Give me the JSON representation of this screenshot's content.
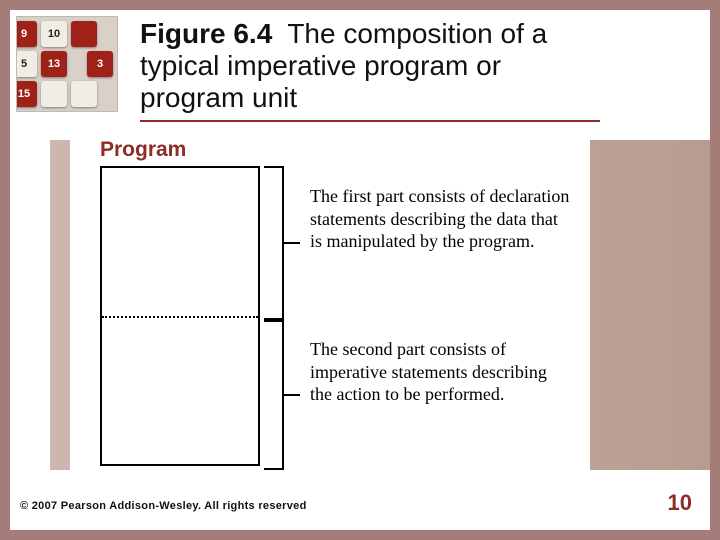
{
  "title": {
    "fignum": "Figure 6.4",
    "rest": "  The composition of a typical imperative program or program unit"
  },
  "diagram": {
    "label": "Program",
    "part1": "The first part consists of declaration statements describing the data that is manipulated by the program.",
    "part2": "The second part consists of imperative statements describing the action to be performed."
  },
  "footer": {
    "copyright": "© 2007 Pearson Addison-Wesley. All rights reserved",
    "pagenum": "10"
  },
  "corner_tiles": [
    "9",
    "10",
    "",
    "5",
    "13",
    "3",
    "15",
    "",
    ""
  ]
}
